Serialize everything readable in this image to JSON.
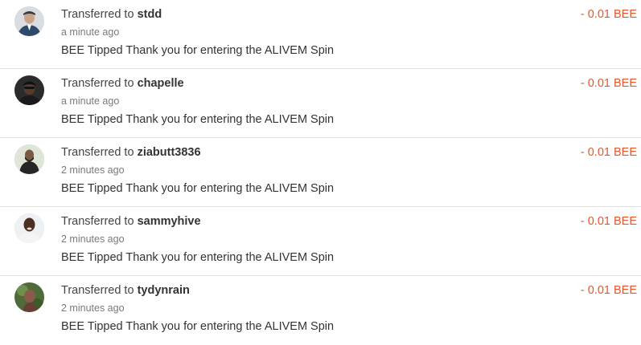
{
  "transfers": [
    {
      "prefix": "Transferred to",
      "user": "stdd",
      "time": "a minute ago",
      "memo": "BEE Tipped Thank you for entering the ALIVEM Spin",
      "amount": "- 0.01 BEE",
      "avatar_icon": "user-avatar-stdd"
    },
    {
      "prefix": "Transferred to",
      "user": "chapelle",
      "time": "a minute ago",
      "memo": "BEE Tipped Thank you for entering the ALIVEM Spin",
      "amount": "- 0.01 BEE",
      "avatar_icon": "user-avatar-chapelle"
    },
    {
      "prefix": "Transferred to",
      "user": "ziabutt3836",
      "time": "2 minutes ago",
      "memo": "BEE Tipped Thank you for entering the ALIVEM Spin",
      "amount": "- 0.01 BEE",
      "avatar_icon": "user-avatar-ziabutt3836"
    },
    {
      "prefix": "Transferred to",
      "user": "sammyhive",
      "time": "2 minutes ago",
      "memo": "BEE Tipped Thank you for entering the ALIVEM Spin",
      "amount": "- 0.01 BEE",
      "avatar_icon": "user-avatar-sammyhive"
    },
    {
      "prefix": "Transferred to",
      "user": "tydynrain",
      "time": "2 minutes ago",
      "memo": "BEE Tipped Thank you for entering the ALIVEM Spin",
      "amount": "- 0.01 BEE",
      "avatar_icon": "user-avatar-tydynrain"
    }
  ],
  "colors": {
    "amount": "#e4572e",
    "divider": "#e2e2e2",
    "muted_text": "#7a7a7a"
  }
}
